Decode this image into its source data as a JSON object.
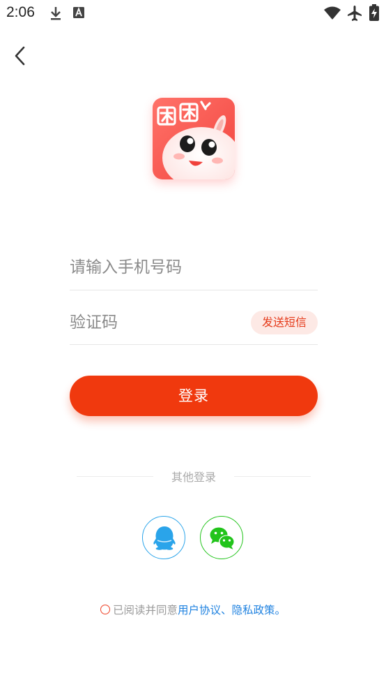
{
  "status_bar": {
    "time": "2:06",
    "left_icons": [
      "download-icon",
      "font-a-icon"
    ],
    "right_icons": [
      "wifi-icon",
      "airplane-icon",
      "battery-charging-icon"
    ]
  },
  "nav": {
    "back_icon": "chevron-left-icon"
  },
  "logo": {
    "text": "团团"
  },
  "phone_input": {
    "placeholder": "请输入手机号码",
    "value": ""
  },
  "code_input": {
    "placeholder": "验证码",
    "value": ""
  },
  "send_sms_label": "发送短信",
  "login_label": "登录",
  "other_login": {
    "label": "其他登录",
    "options": [
      "qq-icon",
      "wechat-icon"
    ]
  },
  "agreement": {
    "prefix": "已阅读并同意",
    "user_agreement": "用户协议",
    "separator": "、",
    "privacy_policy": "隐私政策",
    "suffix": "。"
  },
  "colors": {
    "primary": "#f0390e",
    "send_sms_bg": "#fde9e5",
    "send_sms_text": "#e53a1a",
    "link": "#1f82e0",
    "qq": "#2aa4ea",
    "wechat": "#22c41b"
  }
}
